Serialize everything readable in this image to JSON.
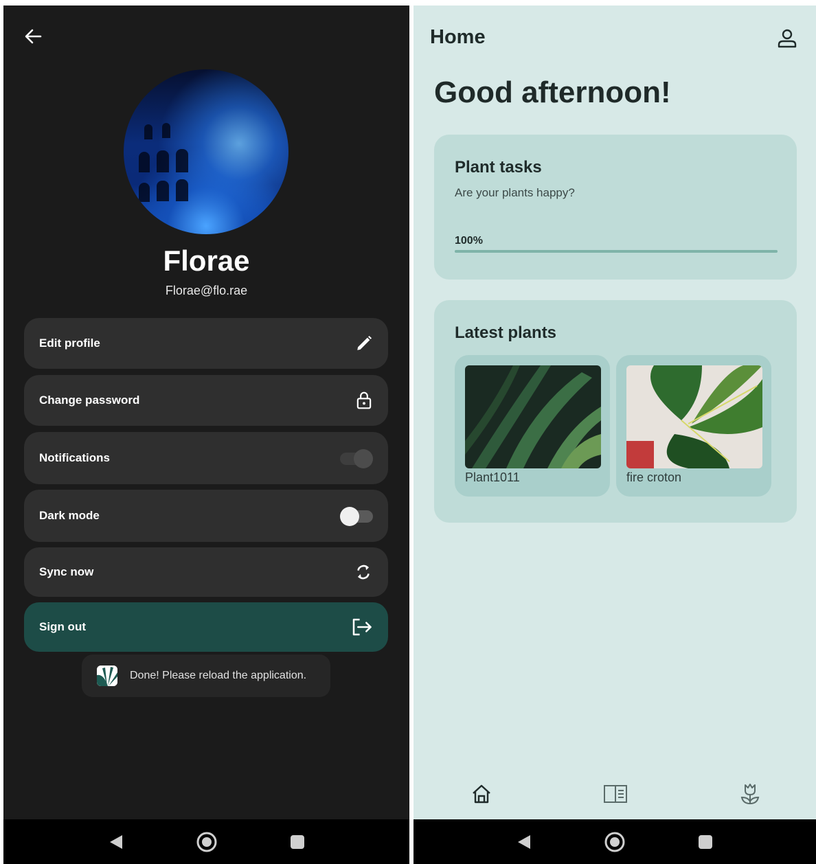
{
  "left_screen": {
    "profile": {
      "name": "Florae",
      "email": "Florae@flo.rae"
    },
    "menu": [
      {
        "label": "Edit profile",
        "icon": "pencil-icon"
      },
      {
        "label": "Change password",
        "icon": "lock-icon"
      },
      {
        "label": "Notifications",
        "control": "toggle",
        "state": "off"
      },
      {
        "label": "Dark mode",
        "control": "toggle",
        "state": "off"
      },
      {
        "label": "Sync now",
        "icon": "sync-icon"
      },
      {
        "label": "Sign out",
        "icon": "logout-icon"
      }
    ],
    "toast": {
      "text": "Done! Please reload the application.",
      "icon": "app-logo-icon"
    },
    "colors": {
      "background": "#1b1b1b",
      "item": "#2f2f2f",
      "signout": "#1d4c47"
    }
  },
  "right_screen": {
    "header": {
      "title": "Home",
      "icon": "account-icon"
    },
    "greeting": "Good afternoon!",
    "plant_tasks": {
      "title": "Plant tasks",
      "subtitle": "Are your plants happy?",
      "progress_label": "100%",
      "progress": 1.0
    },
    "latest_plants": {
      "title": "Latest plants",
      "items": [
        {
          "name": "Plant1011"
        },
        {
          "name": "fire croton"
        }
      ]
    },
    "bottom_nav": [
      "home-icon",
      "catalog-icon",
      "flower-icon"
    ],
    "colors": {
      "background": "#d7e9e7",
      "card": "#bfdcd8",
      "plant_card": "#a9cfcb",
      "progress": "#7fb4a9"
    }
  },
  "system_nav": [
    "back-triangle-icon",
    "home-circle-icon",
    "recents-square-icon"
  ]
}
